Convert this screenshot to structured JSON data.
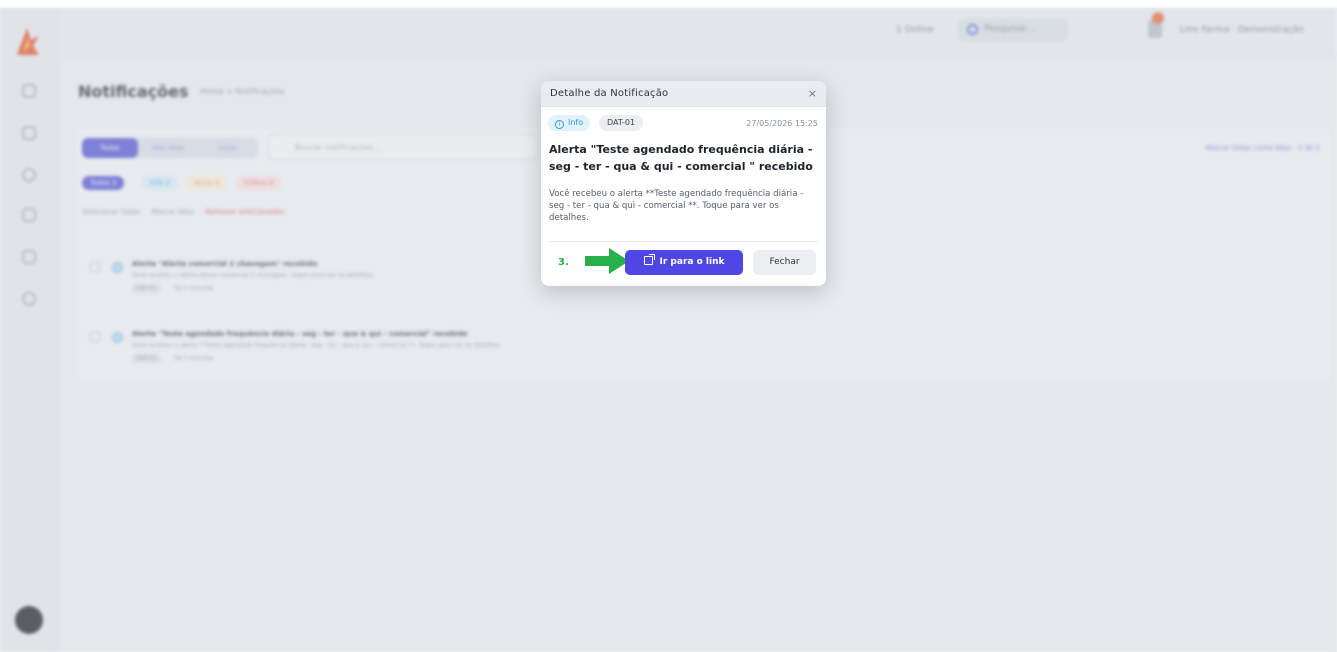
{
  "app": {
    "topbar": {
      "online": "1 Online",
      "search_placeholder": "Pesquisar...",
      "user": "Lino Farma · Demonstração"
    },
    "page": {
      "title": "Notificações",
      "breadcrumb": "Home  >  Notificações"
    },
    "tabs": [
      "Todas",
      "Não lidas",
      "Lidas"
    ],
    "filter_placeholder": "Buscar notificações...",
    "chips": [
      "Todos 2",
      "Info 2",
      "Aviso 0",
      "Crítico 0"
    ],
    "selection": {
      "select_all": "Selecionar todas",
      "mark_read": "Marcar lidas",
      "remove": "Remover selecionadas"
    },
    "mark_all_read": "Marcar todas como lidas  ·  2 de 2",
    "notifications": [
      {
        "title": "Alerta \"Alerta comercial 2 chavagem\" recebido",
        "desc": "Você recebeu o alerta Alerta comercial 2 chavagem. Toque para ver os detalhes.",
        "tag": "DAT-01",
        "ago": "há 3 minutos"
      },
      {
        "title": "Alerta \"Teste agendado frequência diária - seg - ter - qua & qui - comercial\" recebido",
        "desc": "Você recebeu o alerta **Teste agendado frequência diária - seg - ter - qua & qui - comercial **. Toque para ver os detalhes.",
        "tag": "DAT-01",
        "ago": "há 7 minutos"
      }
    ]
  },
  "modal": {
    "title": "Detalhe da Notificação",
    "close_glyph": "×",
    "badge_type": "Info",
    "badge_code": "DAT-01",
    "date": "27/05/2026 15:25",
    "heading": "Alerta \"Teste agendado frequência diária - seg - ter - qua & qui - comercial \" recebido",
    "body": "Você recebeu o alerta **Teste agendado frequência diária - seg - ter - qua & qui - comercial **. Toque para ver os detalhes.",
    "step_label": "3.",
    "primary_button": "Ir para o link",
    "secondary_button": "Fechar"
  },
  "colors": {
    "accent": "#4f46e5",
    "info": "#2f9bd8",
    "step_arrow": "#27b04a"
  },
  "icons": {
    "info_badge": "info-circle-icon",
    "external_link": "external-link-icon",
    "close": "close-icon",
    "annotation_arrow": "green-arrow-icon"
  }
}
